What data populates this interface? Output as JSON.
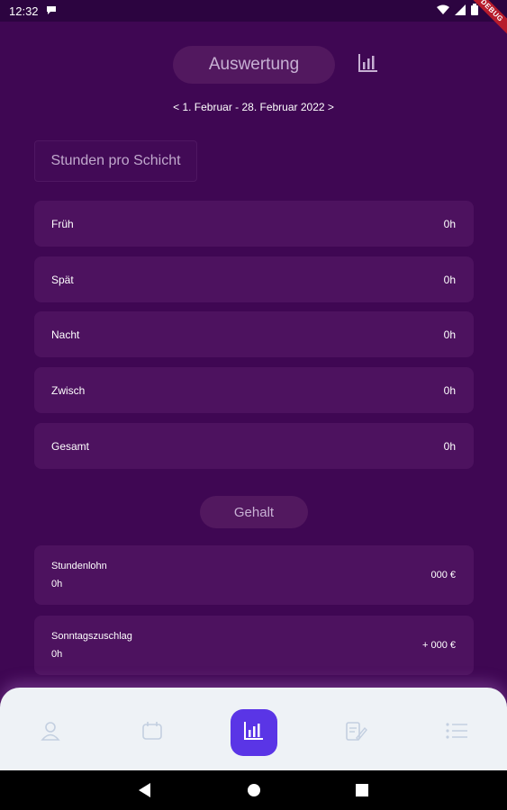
{
  "status_bar": {
    "time": "12:32",
    "debug_label": "DEBUG"
  },
  "header": {
    "title": "Auswertung"
  },
  "date_range": "< 1. Februar - 28. Februar 2022 >",
  "section_hours": {
    "title": "Stunden pro Schicht",
    "rows": [
      {
        "label": "Früh",
        "value": "0h"
      },
      {
        "label": "Spät",
        "value": "0h"
      },
      {
        "label": "Nacht",
        "value": "0h"
      },
      {
        "label": "Zwisch",
        "value": "0h"
      },
      {
        "label": "Gesamt",
        "value": "0h"
      }
    ]
  },
  "section_salary": {
    "title": "Gehalt",
    "rows": [
      {
        "label": "Stundenlohn",
        "sub": "0h",
        "value": "000 €"
      },
      {
        "label": "Sonntagszuschlag",
        "sub": "0h",
        "value": "+ 000 €"
      }
    ]
  },
  "bottom_nav": [
    {
      "icon": "person-icon"
    },
    {
      "icon": "calendar-icon"
    },
    {
      "icon": "bar-chart-icon",
      "active": true
    },
    {
      "icon": "clipboard-edit-icon"
    },
    {
      "icon": "list-icon"
    }
  ],
  "colors": {
    "background": "#3f0753",
    "card": "#4d125f",
    "accent": "#5a35e6",
    "nav_background": "#eef2f6"
  }
}
